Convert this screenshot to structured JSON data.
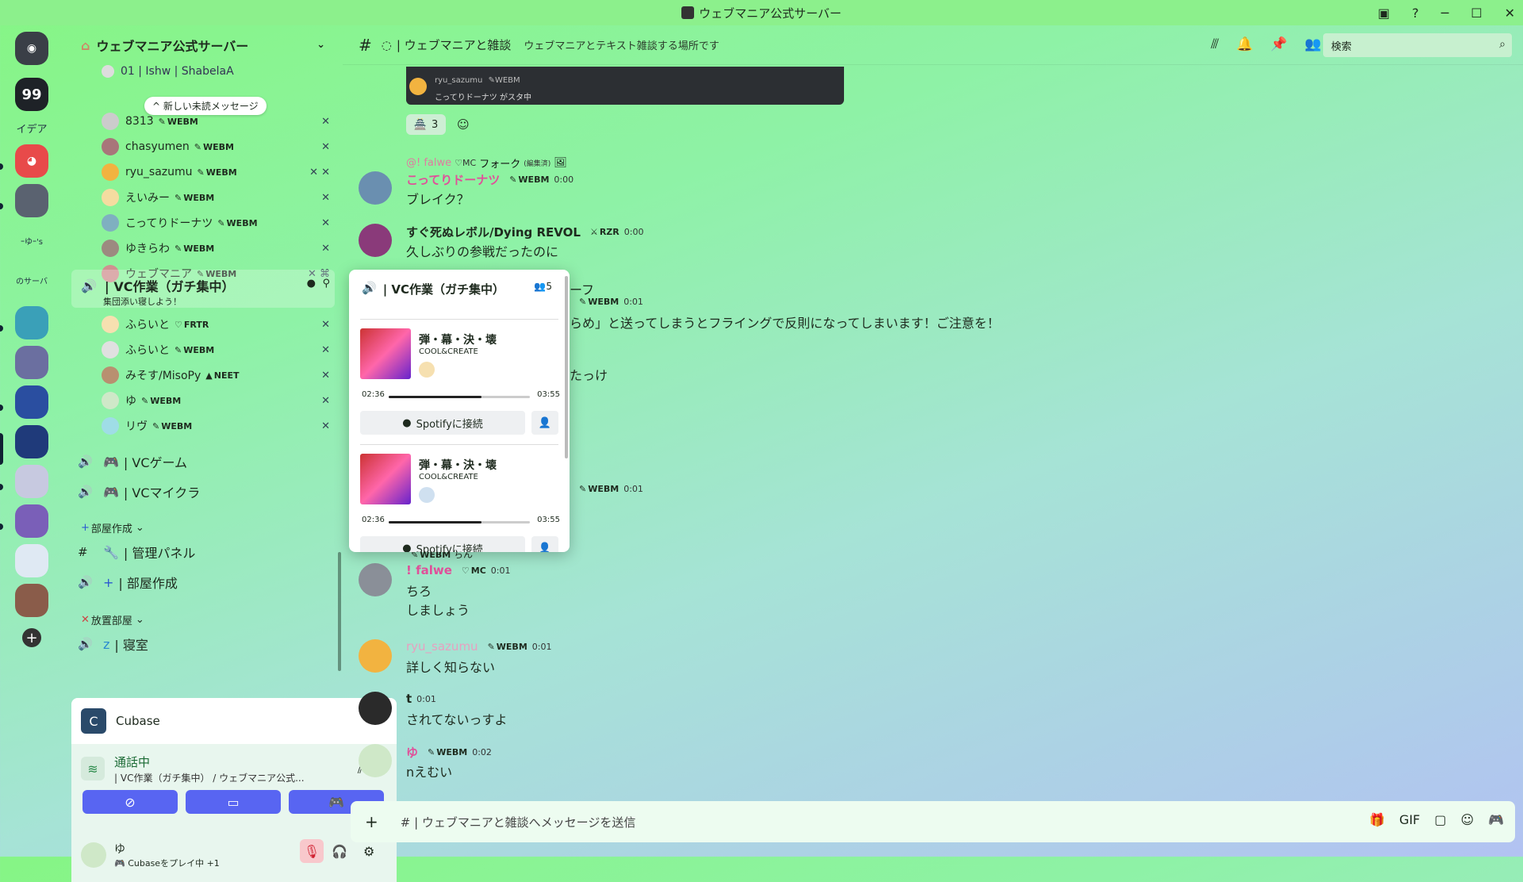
{
  "window": {
    "title": "ウェブマニア公式サーバー",
    "icons": [
      "inbox-icon",
      "help-icon",
      "minimize-icon",
      "maximize-icon",
      "close-icon"
    ]
  },
  "rail": {
    "servers": [
      {
        "label": "",
        "color": "#3a3f47"
      },
      {
        "label": "99",
        "color": "#1e2227"
      },
      {
        "label": "イデア",
        "color": "transparent"
      },
      {
        "label": "",
        "color": "#e84a4a"
      },
      {
        "label": "",
        "color": "#5a6270"
      },
      {
        "label": "ｰゆｰ's",
        "color": "transparent"
      },
      {
        "label": "のサーバ",
        "color": "transparent"
      },
      {
        "label": "",
        "color": "#3aa0b8"
      },
      {
        "label": "",
        "color": "#6b6fa0"
      },
      {
        "label": "",
        "color": "#2a4ea0"
      },
      {
        "label": "",
        "color": "#1f3a7a"
      },
      {
        "label": "",
        "color": "#c7c9e0"
      },
      {
        "label": "",
        "color": "#7a5fb8"
      },
      {
        "label": "",
        "color": "#dfe9f3"
      },
      {
        "label": "",
        "color": "#8a5c4a"
      }
    ],
    "add_label": "+"
  },
  "sidebar": {
    "server_name": "ウェブマニア公式サーバー",
    "new_unread": "新しい未読メッセージ",
    "top_members": [
      {
        "name": "01 | Ishw | ShabelaA",
        "tag": ""
      },
      {
        "name": "8313",
        "tag": "WEBM"
      },
      {
        "name": "chasyumen",
        "tag": "WEBM"
      },
      {
        "name": "ryu_sazumu",
        "tag": "WEBM"
      },
      {
        "name": "えいみー",
        "tag": "WEBM"
      },
      {
        "name": "こってりドーナツ",
        "tag": "WEBM"
      },
      {
        "name": "ゆきらわ",
        "tag": "WEBM"
      },
      {
        "name": "ウェブマニア",
        "tag": "WEBM"
      }
    ],
    "vc_channel": {
      "name": "| VC作業（ガチ集中）",
      "status": "集団添い寝しよう！"
    },
    "vc_members": [
      {
        "name": "ふらいと",
        "tag": "FRTR"
      },
      {
        "name": "ふらいと",
        "tag": "WEBM"
      },
      {
        "name": "みそす/MisoPy",
        "tag": "NEET"
      },
      {
        "name": "ゆ",
        "tag": "WEBM"
      },
      {
        "name": "リヴ",
        "tag": "WEBM"
      }
    ],
    "channels": [
      {
        "name": "| VCゲーム"
      },
      {
        "name": "| VCマイクラ"
      }
    ],
    "category1": "部屋作成",
    "cat1_channels": [
      {
        "name": "| 管理パネル"
      },
      {
        "name": "| 部屋作成"
      }
    ],
    "category2": "放置部屋",
    "cat2_channels": [
      {
        "name": "| 寝室"
      }
    ],
    "activity": {
      "app": "Cubase"
    },
    "voice": {
      "status": "通話中",
      "location": "| VC作業（ガチ集中） / ウェブマニア公式..."
    },
    "user": {
      "name": "ゆ",
      "status": "Cubaseをプレイ中 +1"
    }
  },
  "main": {
    "channel_name": "| ウェブマニアと雑談",
    "topic": "ウェブマニアとテキスト雑談する場所です",
    "search_placeholder": "検索",
    "reaction_count": "3",
    "embed_name": "ryu_sazumu",
    "embed_tag": "WEBM",
    "embed_text": "こってりドーナツ がスタ中",
    "messages": [
      {
        "reply": "@! falwe",
        "reply_tag": "MC",
        "reply_text": "フォーク",
        "reply_edit": "(編集済)",
        "name": "こってりドーナツ",
        "tag": "WEBM",
        "time": "0:00",
        "text": "ブレイク？",
        "color": "#e0509a"
      },
      {
        "name": "すぐ死ぬレボル/Dying REVOL",
        "tag": "RZR",
        "time": "0:00",
        "text": "久しぶりの参戦だったのに",
        "color": "#111"
      },
      {
        "partial": "ーフ",
        "tag": "WEBM",
        "time": "0:01",
        "text": "らめ」と送ってしまうとフライングで反則になってしまいます！ご注意を！"
      },
      {
        "partial": "たっけ"
      },
      {
        "tag": "WEBM",
        "time": "0:01"
      },
      {
        "reply_tag": "WEBM",
        "reply_text": "ちん",
        "name": "! falwe",
        "tag": "MC",
        "time": "0:01",
        "text": "ちろ",
        "text2": "しましょう",
        "color": "#e0509a"
      },
      {
        "name": "ryu_sazumu",
        "tag": "WEBM",
        "time": "0:01",
        "text": "詳しく知らない",
        "color": "#e7a0c0"
      },
      {
        "name": "t",
        "time": "0:01",
        "text": "されてないっすよ",
        "color": "#111"
      },
      {
        "name": "ゆ",
        "tag": "WEBM",
        "time": "0:02",
        "text": "nえむい",
        "color": "#e0509a"
      }
    ],
    "composer_placeholder": "# | ウェブマニアと雑談へメッセージを送信"
  },
  "popup": {
    "title": "| VC作業（ガチ集中）",
    "count": "5",
    "tracks": [
      {
        "title": "弾・幕・決・壊",
        "artist": "COOL&CREATE",
        "elapsed": "02:36",
        "total": "03:55",
        "progress": 0.66,
        "connect": "Spotifyに接続"
      },
      {
        "title": "弾・幕・決・壊",
        "artist": "COOL&CREATE",
        "elapsed": "02:36",
        "total": "03:55",
        "progress": 0.66,
        "connect": "Spotifyに接続"
      }
    ]
  },
  "colors": {
    "accent": "#5865f2",
    "bg_top": "#86f585",
    "bg_bottom": "#b2c2f2"
  }
}
